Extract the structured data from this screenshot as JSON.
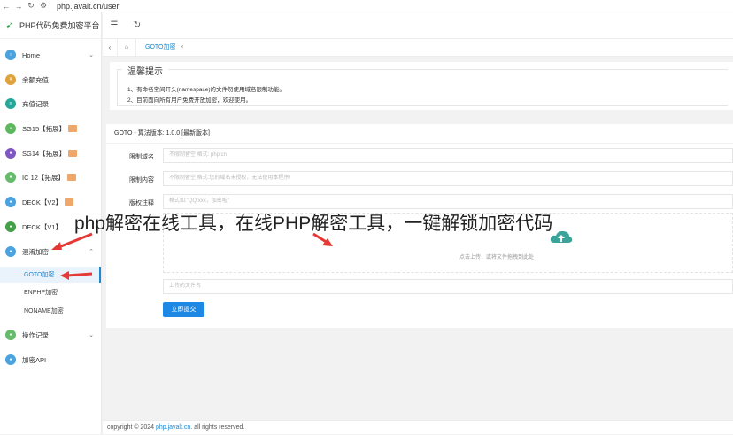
{
  "browser": {
    "url": "php.javalt.cn/user"
  },
  "app": {
    "title": "PHP代码免费加密平台"
  },
  "sidebar": {
    "items": [
      {
        "label": "Home",
        "color": "#4aa3df"
      },
      {
        "label": "余额充值",
        "color": "#e0a23a"
      },
      {
        "label": "充值记录",
        "color": "#26a69a"
      },
      {
        "label": "SG15【拓展】",
        "color": "#5cb85c"
      },
      {
        "label": "SG14【拓展】",
        "color": "#7e57c2"
      },
      {
        "label": "IC 12【拓展】",
        "color": "#66bb6a"
      },
      {
        "label": "DECK【V2】",
        "color": "#4aa3df"
      },
      {
        "label": "DECK【V1】",
        "color": "#43a047"
      },
      {
        "label": "混淆加密",
        "color": "#4aa3df"
      },
      {
        "label": "操作记录",
        "color": "#66bb6a"
      },
      {
        "label": "加密API",
        "color": "#4aa3df"
      }
    ],
    "subitems": [
      {
        "label": "GOTO加密"
      },
      {
        "label": "ENPHP加密"
      },
      {
        "label": "NONAME加密"
      }
    ]
  },
  "tabs": {
    "active": "GOTO加密",
    "close": "×"
  },
  "notice": {
    "title": "温馨提示",
    "lines": [
      "1、有命名空间开头(namespace)的文件勿使用域名限制功能。",
      "2、目前面向所有用户免费开放加密，欢迎使用。"
    ]
  },
  "form": {
    "header": "GOTO - 算法版本: 1.0.0 [最新版本]",
    "domain_label": "限制域名",
    "domain_placeholder": "不限制留空 格式: php.cn",
    "content_label": "限制内容",
    "content_placeholder": "不限制留空 格式:您的域名未授权，无法使用本程序!",
    "copyright_label": "版权注释",
    "copyright_placeholder": "格式如:\"QQ:xxx，加密啦\"",
    "upload_text": "点击上传，或将文件拖拽到此处",
    "uploaded_placeholder": "上传的文件名",
    "submit_label": "立即提交"
  },
  "footer": {
    "prefix": "copyright © 2024 ",
    "link": "php.javalt.cn",
    "suffix": ". all rights reserved."
  },
  "watermark": "php解密在线工具，在线PHP解密工具，一键解锁加密代码"
}
